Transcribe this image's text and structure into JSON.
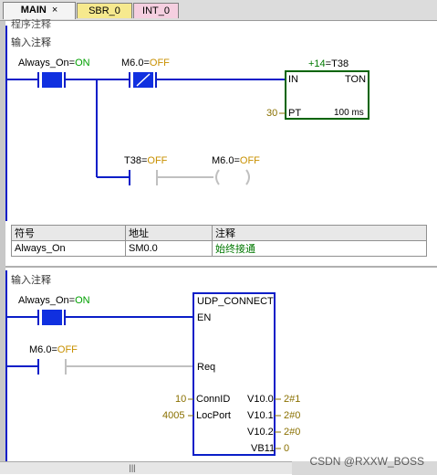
{
  "tabs": [
    {
      "label": "MAIN",
      "close": "×"
    },
    {
      "label": "SBR_0"
    },
    {
      "label": "INT_0"
    }
  ],
  "network1": {
    "cut_comment": "程序注释",
    "comment": "输入注释",
    "contact1_label": "Always_On",
    "contact1_state": "ON",
    "contact2_label": "M6.0",
    "contact2_state": "OFF",
    "timer_header_prefix": "+14",
    "timer_header_name": "T38",
    "timer_in": "IN",
    "timer_type": "TON",
    "timer_pt_value": "30",
    "timer_pt": "PT",
    "timer_base": "100 ms",
    "contact3_label": "T38",
    "contact3_state": "OFF",
    "coil_label": "M6.0",
    "coil_state": "OFF"
  },
  "symbol_table": {
    "headers": [
      "符号",
      "地址",
      "注释"
    ],
    "rows": [
      [
        "Always_On",
        "SM0.0",
        "始终接通"
      ]
    ]
  },
  "network2": {
    "comment": "输入注释",
    "contact1_label": "Always_On",
    "contact1_state": "ON",
    "contact2_label": "M6.0",
    "contact2_state": "OFF",
    "box_title": "UDP_CONNECT",
    "box_en": "EN",
    "box_req": "Req",
    "connid_value": "10",
    "connid": "ConnID",
    "locport_value": "4005",
    "locport": "LocPort",
    "outputs": [
      {
        "pin": "V10.0",
        "value": "2#1"
      },
      {
        "pin": "V10.1",
        "value": "2#0"
      },
      {
        "pin": "V10.2",
        "value": "2#0"
      },
      {
        "pin": "VB11",
        "value": "0"
      }
    ]
  },
  "scrollbar_thumb": "|||",
  "watermark": "CSDN @RXXW_BOSS",
  "colors": {
    "rung": "#0a1ec8",
    "energized_contact": "#1030e0",
    "deenergized": "#c0c0c0",
    "timer_box": "#006400",
    "on_state": "#00a000",
    "off_state": "#c89000"
  }
}
